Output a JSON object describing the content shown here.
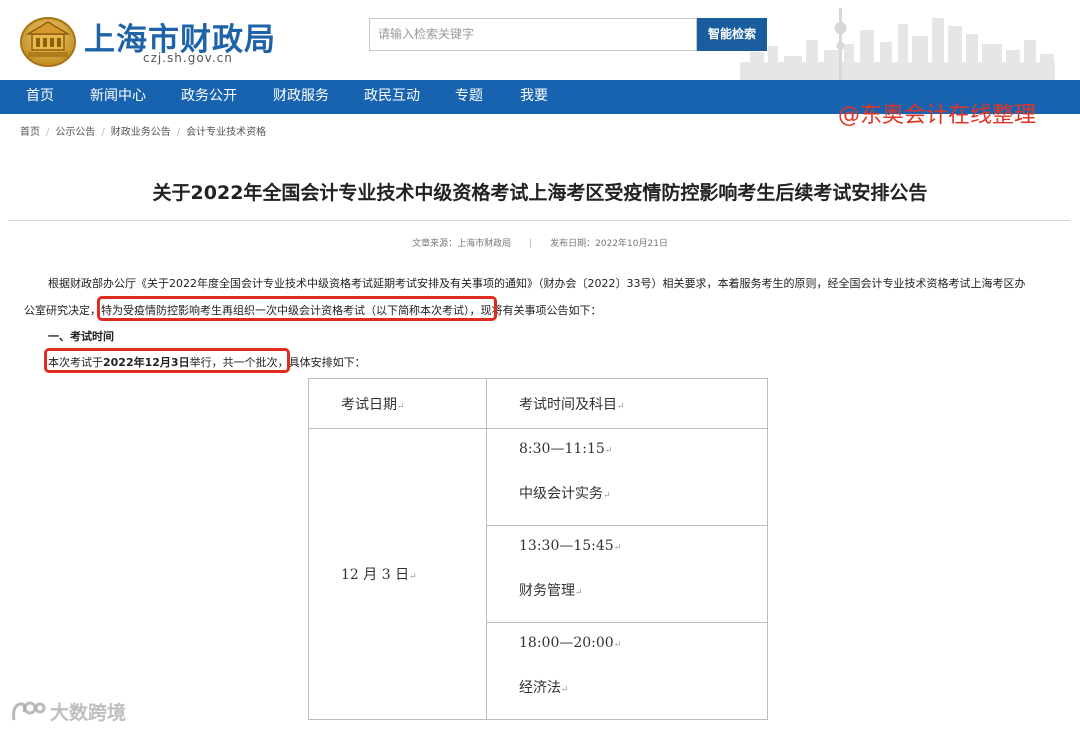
{
  "header": {
    "site_title": "上海市财政局",
    "domain": "czj.sh.gov.cn",
    "search_placeholder": "请输入检索关键字",
    "search_button": "智能检索"
  },
  "nav": {
    "items": [
      "首页",
      "新闻中心",
      "政务公开",
      "财政服务",
      "政民互动",
      "专题",
      "我要"
    ]
  },
  "watermarks": {
    "top": "@东奥会计在线整理",
    "bottom": "大数跨境"
  },
  "breadcrumb": [
    "首页",
    "公示公告",
    "财政业务公告",
    "会计专业技术资格"
  ],
  "article": {
    "title": "关于2022年全国会计专业技术中级资格考试上海考区受疫情防控影响考生后续考试安排公告",
    "source": "文章来源：上海市财政局",
    "date": "发布日期：2022年10月21日",
    "para1": "根据财政部办公厅《关于2022年度全国会计专业技术中级资格考试延期考试安排及有关事项的通知》（财办会〔2022〕33号）相关要求，本着服务考生的原则，经全国会计专业技术资格考试上海考区办",
    "para2_lead": "公室研究决定，",
    "para2_highlight": "特为受疫情防控影响考生再组织一次中级会计资格考试（以下简称本次考试）",
    "para2_tail": "，现将有关事项公告如下：",
    "section1": "一、考试时间",
    "para3_a": "本次考试于",
    "para3_bold": "2022年12月3日",
    "para3_b": "举行，共一个批次，",
    "para3_tail": "具体安排如下："
  },
  "schedule": {
    "header_date": "考试日期",
    "header_time": "考试时间及科目",
    "date": "12 月 3 日",
    "slots": [
      {
        "time": "8:30—11:15",
        "subject": "中级会计实务"
      },
      {
        "time": "13:30—15:45",
        "subject": "财务管理"
      },
      {
        "time": "18:00—20:00",
        "subject": "经济法"
      }
    ]
  },
  "colors": {
    "brand_blue": "#1863b0",
    "highlight_red": "#e02b20"
  }
}
